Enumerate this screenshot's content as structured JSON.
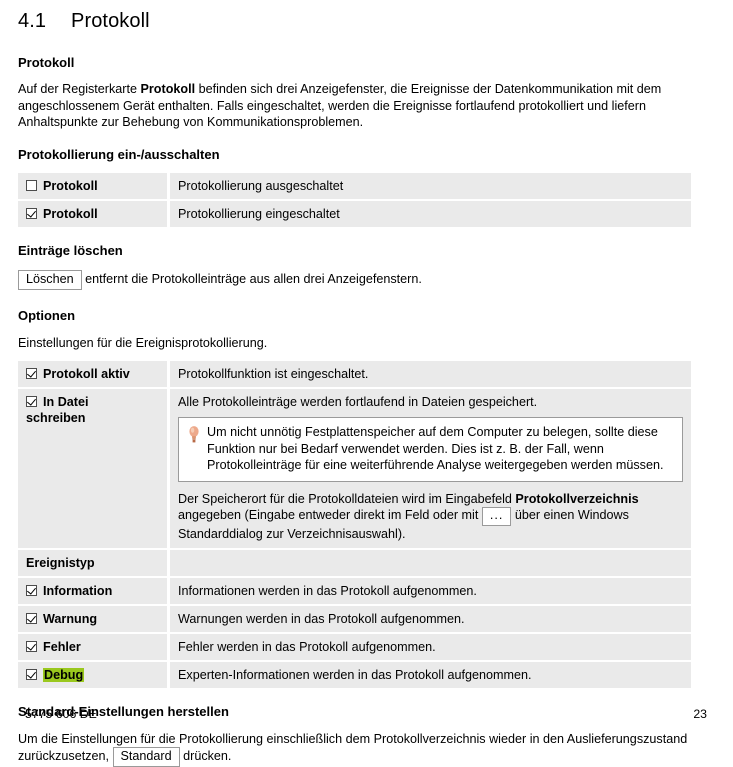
{
  "document": {
    "chapter_number": "4.1",
    "chapter_title": "Protokoll",
    "footer_left": "5775 606 DE",
    "footer_page": "23"
  },
  "colors": {
    "table_row_bg": "#eaeaea",
    "highlight": "#9ac81e",
    "note_border": "#9a9a9a",
    "bulb": "#e8a87c"
  },
  "sections": {
    "intro": {
      "heading": "Protokoll",
      "paragraph_pre": "Auf der Registerkarte ",
      "paragraph_bold": "Protokoll",
      "paragraph_post": " befinden sich drei Anzeigefenster, die Ereignisse der Datenkommunikation mit dem angeschlossenem Gerät enthalten. Falls eingeschaltet, werden die Ereignisse fortlaufend protokolliert und liefern Anhaltspunkte zur Behebung von Kommunikationsproblemen."
    },
    "toggle": {
      "heading": "Protokollierung ein-/ausschalten",
      "rows": [
        {
          "checked": false,
          "label": "Protokoll",
          "desc": "Protokollierung ausgeschaltet"
        },
        {
          "checked": true,
          "label": "Protokoll",
          "desc": "Protokollierung eingeschaltet"
        }
      ]
    },
    "clear": {
      "heading": "Einträge löschen",
      "button_label": "Löschen",
      "text": "entfernt die Protokolleinträge aus allen drei Anzeigefenstern."
    },
    "options": {
      "heading": "Optionen",
      "intro": "Einstellungen für die Ereignisprotokollierung.",
      "row_active": {
        "checked": true,
        "label": "Protokoll aktiv",
        "desc": "Protokollfunktion ist eingeschaltet."
      },
      "row_file": {
        "checked": true,
        "label_line1": "In Datei",
        "label_line2": "schreiben",
        "desc": "Alle Protokolleinträge werden fortlaufend in Dateien gespeichert.",
        "note": "Um nicht unnötig Festplattenspeicher auf dem Computer zu belegen, sollte diese Funktion nur bei Bedarf verwendet werden. Dies ist z. B. der Fall, wenn Protokolleinträge für eine weiterführende Analyse weitergegeben werden müssen.",
        "after_pre": "Der Speicherort für die Protokolldateien wird im Eingabefeld ",
        "after_bold": "Protokollverzeichnis",
        "after_mid": " angegeben (Eingabe entweder direkt im Feld oder mit ",
        "after_button": "...",
        "after_post": " über einen Windows Standarddialog zur Verzeichnisauswahl)."
      },
      "event_type_header": "Ereignistyp",
      "event_rows": [
        {
          "checked": true,
          "label": "Information",
          "highlight": false,
          "desc": "Informationen werden in das Protokoll aufgenommen."
        },
        {
          "checked": true,
          "label": "Warnung",
          "highlight": false,
          "desc": "Warnungen werden in das Protokoll aufgenommen."
        },
        {
          "checked": true,
          "label": "Fehler",
          "highlight": false,
          "desc": "Fehler werden in das Protokoll aufgenommen."
        },
        {
          "checked": true,
          "label": "Debug",
          "highlight": true,
          "desc": "Experten-Informationen werden in das Protokoll aufgenommen."
        }
      ]
    },
    "defaults": {
      "heading": "Standard-Einstellungen herstellen",
      "text_pre": "Um die Einstellungen für die Protokollierung einschließlich dem Protokollverzeichnis wieder in den Auslieferungszustand zurückzusetzen, ",
      "button_label": "Standard",
      "text_post": " drücken."
    }
  }
}
